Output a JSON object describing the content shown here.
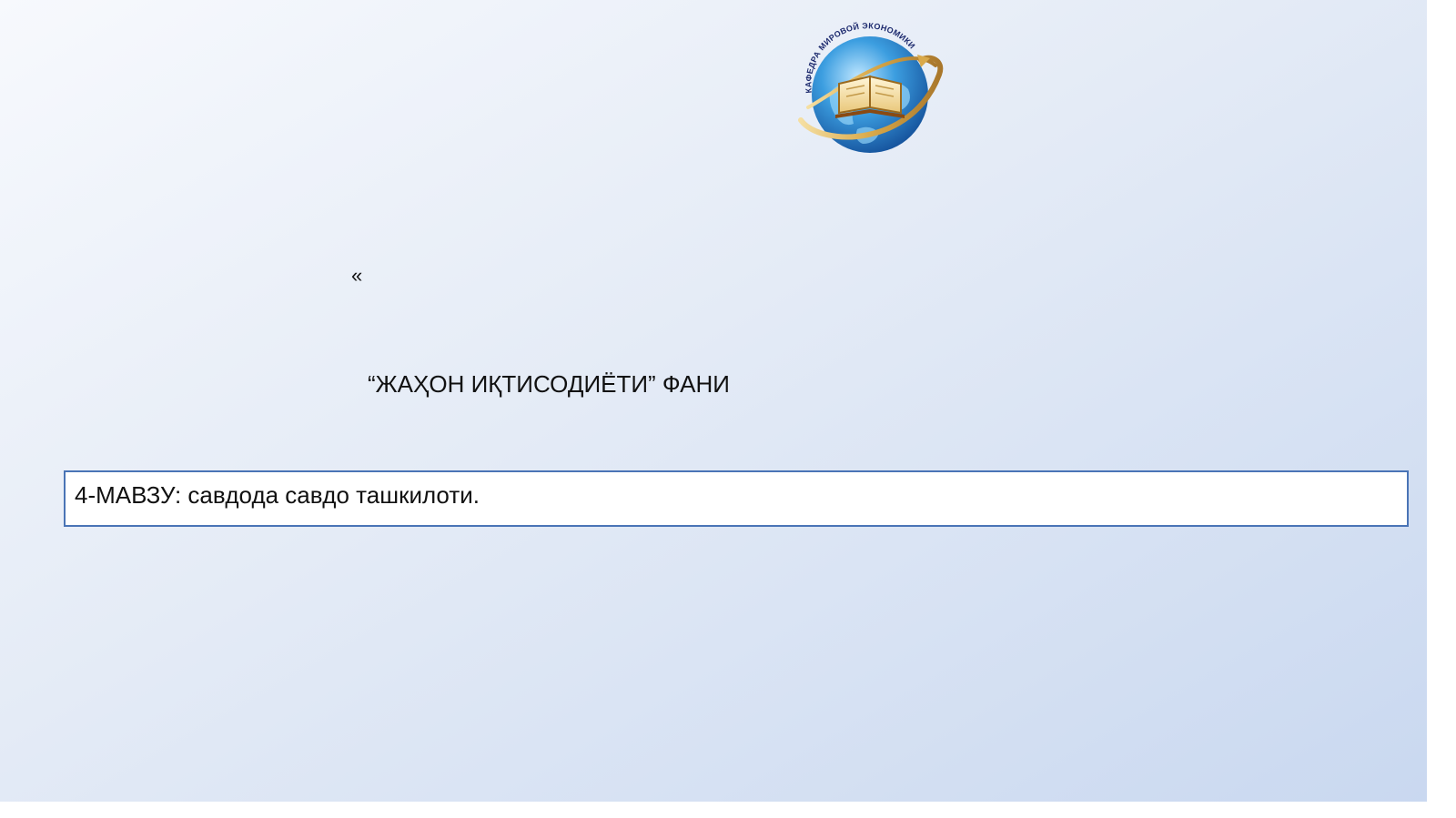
{
  "slide": {
    "logo": {
      "arc_text": "КАФЕДРА МИРОВОЙ ЭКОНОМИКИ",
      "icon": "globe-book-logo"
    },
    "quote_mark": "«",
    "subject_title": "“ЖАҲОН ИҚТИСОДИЁТИ” ФАНИ",
    "topic": "4-МАВЗУ: савдода савдо ташкилоти."
  },
  "colors": {
    "background_light": "#f7f9fd",
    "background_dark": "#c9d8f0",
    "box_border": "#4a74b6",
    "globe_blue": "#2a86d0",
    "ring_gold": "#d9a94a",
    "text": "#111111"
  }
}
